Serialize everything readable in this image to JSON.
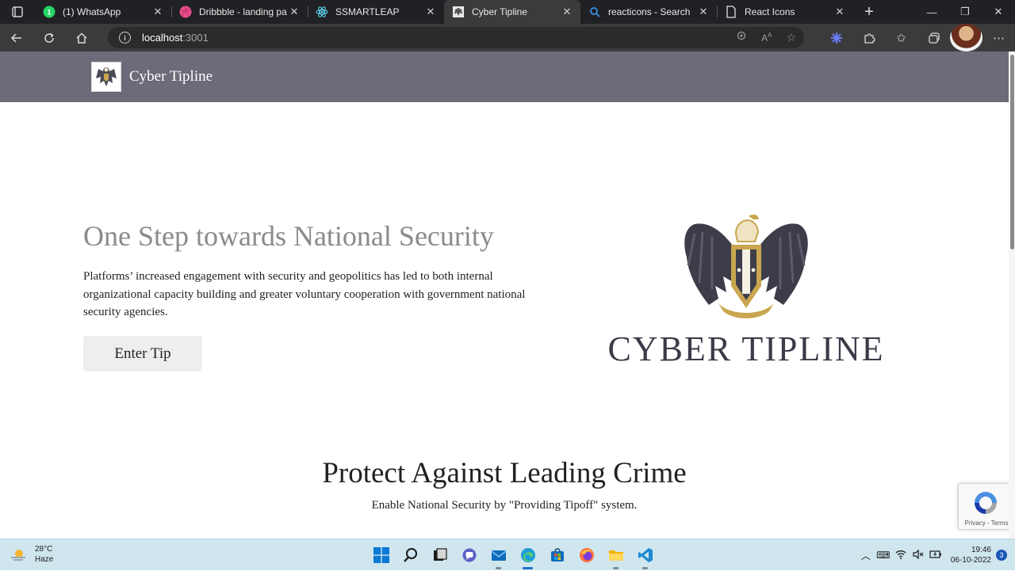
{
  "browser": {
    "tabs": [
      {
        "title": "(1) WhatsApp",
        "icon": "whatsapp-icon",
        "active": false
      },
      {
        "title": "Dribbble - landing page",
        "icon": "dribbble-icon",
        "active": false
      },
      {
        "title": "SSMARTLEAP",
        "icon": "react-icon",
        "active": false
      },
      {
        "title": "Cyber Tipline",
        "icon": "emblem-favicon",
        "active": true
      },
      {
        "title": "reacticons - Search",
        "icon": "search-icon",
        "active": false
      },
      {
        "title": "React Icons",
        "icon": "document-icon",
        "active": false
      }
    ],
    "address": {
      "host": "localhost",
      "port": ":3001"
    }
  },
  "site": {
    "brand": "Cyber Tipline",
    "hero": {
      "title": "One Step towards National Security",
      "text": "Platforms’ increased engagement with security and geopolitics has led to both internal organizational capacity building and greater voluntary cooperation with government national security agencies.",
      "cta": "Enter Tip",
      "emblem_text": "CYBER TIPLINE"
    },
    "section": {
      "title": "Protect Against Leading Crime",
      "subtitle": "Enable National Security by \"Providing Tipoff\" system."
    },
    "recaptcha": {
      "links": "Privacy - Terms"
    }
  },
  "taskbar": {
    "weather": {
      "temp": "28°C",
      "condition": "Haze"
    },
    "clock": {
      "time": "19:46",
      "date": "06-10-2022"
    },
    "notifications": "3"
  },
  "colors": {
    "header_bg": "#6b6b79",
    "hero_title": "#8a8a8a",
    "button_bg": "#eeeeee",
    "browser_chrome": "#3b3b3b"
  }
}
